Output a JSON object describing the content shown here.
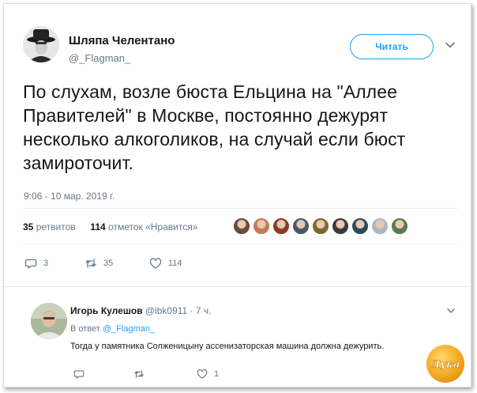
{
  "tweet": {
    "author_name": "Шляпа Челентано",
    "author_handle": "@_Flagman_",
    "follow_label": "Читать",
    "text": "По слухам, возле бюста Ельцина на \"Аллее Правителей\" в Москве, постоянно дежурят несколько алкоголиков, на случай если бюст замироточит.",
    "timestamp": "9:06 - 10 мар. 2019 г.",
    "retweets_count": "35",
    "retweets_label": "ретвитов",
    "likes_count": "114",
    "likes_label": "отметок «Нравится»",
    "likers": [
      {
        "name": "liker-1",
        "color": "#6b4a3a"
      },
      {
        "name": "liker-2",
        "color": "#c47a5a"
      },
      {
        "name": "liker-3",
        "color": "#8a3a2a"
      },
      {
        "name": "liker-4",
        "color": "#4a5a6a"
      },
      {
        "name": "liker-5",
        "color": "#7a6a2a"
      },
      {
        "name": "liker-6",
        "color": "#3a3a3a"
      },
      {
        "name": "liker-7",
        "color": "#2a4a5a"
      },
      {
        "name": "liker-8",
        "color": "#aab8c2"
      },
      {
        "name": "liker-9",
        "color": "#5a7a4a"
      }
    ],
    "actions": {
      "reply_count": "3",
      "retweet_count": "35",
      "like_count": "114"
    }
  },
  "reply": {
    "author_name": "Игорь Кулешов",
    "author_handle": "@ibk0911",
    "time": "· 7 ч.",
    "in_reply_prefix": "В ответ",
    "in_reply_handle": "@_Flagman_",
    "text": "Тогда у памятника Солженицыну ассенизаторская машина должна дежурить.",
    "like_count": "1"
  },
  "watermark": {
    "text": "Лука"
  },
  "colors": {
    "accent": "#1da1f2",
    "muted": "#657786",
    "text": "#14171a"
  }
}
